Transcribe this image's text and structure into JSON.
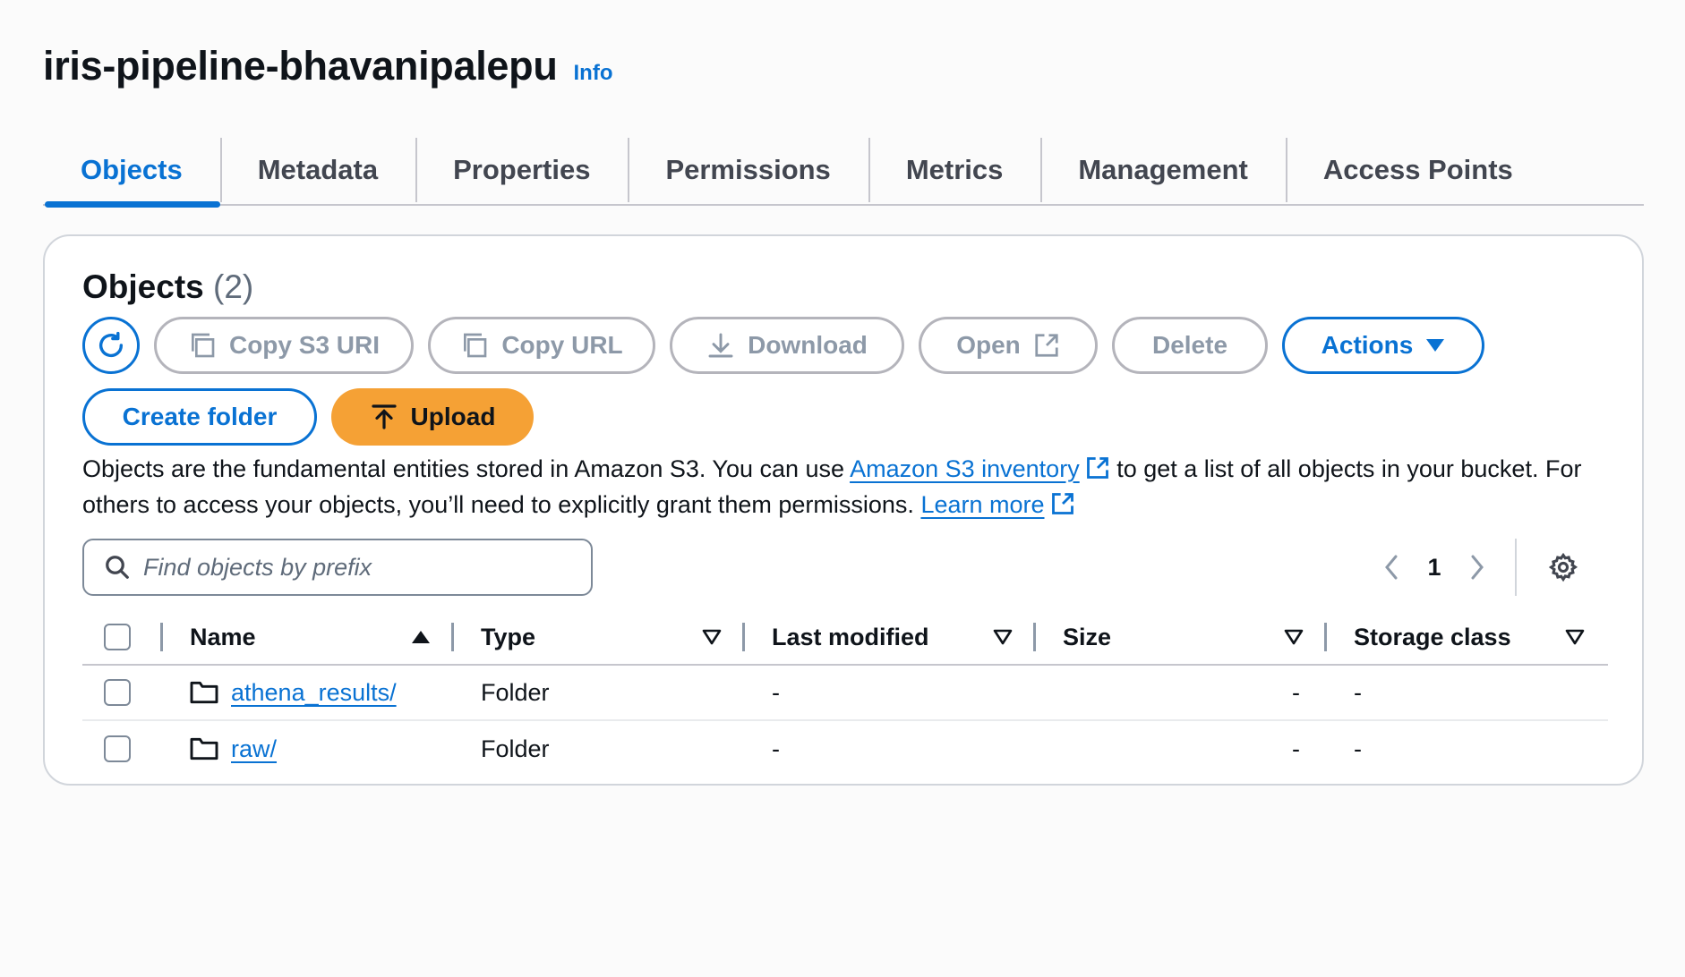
{
  "header": {
    "title": "iris-pipeline-bhavanipalepu",
    "info": "Info"
  },
  "tabs": [
    {
      "label": "Objects",
      "active": true
    },
    {
      "label": "Metadata"
    },
    {
      "label": "Properties"
    },
    {
      "label": "Permissions"
    },
    {
      "label": "Metrics"
    },
    {
      "label": "Management"
    },
    {
      "label": "Access Points"
    }
  ],
  "objects": {
    "title": "Objects",
    "count": "(2)",
    "toolbar": {
      "refresh_icon": "refresh-icon",
      "copy_s3_uri": "Copy S3 URI",
      "copy_url": "Copy URL",
      "download": "Download",
      "open": "Open",
      "delete": "Delete",
      "actions": "Actions",
      "create_folder": "Create folder",
      "upload": "Upload"
    },
    "description": {
      "part1": "Objects are the fundamental entities stored in Amazon S3. You can use ",
      "link1": "Amazon S3 inventory",
      "part2": " to get a list of all objects in your bucket. For others to access your objects, you’ll need to explicitly grant them permissions. ",
      "link2": "Learn more"
    },
    "search": {
      "placeholder": "Find objects by prefix",
      "value": ""
    },
    "pagination": {
      "current_page": "1"
    },
    "table": {
      "columns": [
        "Name",
        "Type",
        "Last modified",
        "Size",
        "Storage class"
      ],
      "rows": [
        {
          "name": "athena_results/",
          "type": "Folder",
          "last_modified": "-",
          "size": "-",
          "storage_class": "-"
        },
        {
          "name": "raw/",
          "type": "Folder",
          "last_modified": "-",
          "size": "-",
          "storage_class": "-"
        }
      ]
    }
  },
  "colors": {
    "accent": "#0972d3",
    "upload": "#f5a135",
    "disabled": "#8d99a8",
    "text": "#0f141a"
  }
}
